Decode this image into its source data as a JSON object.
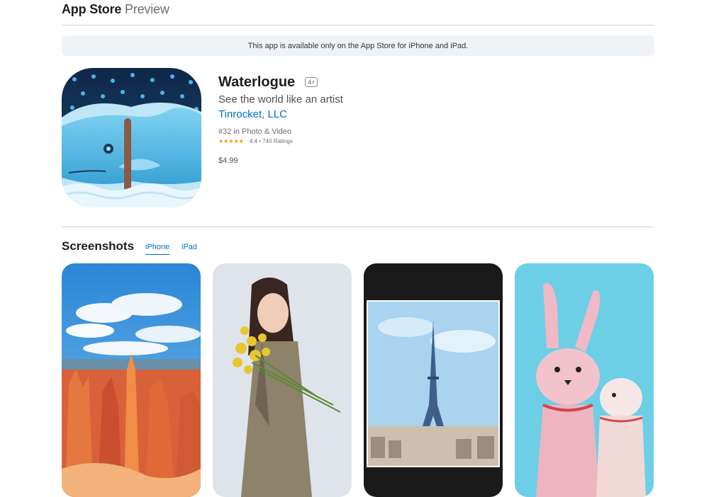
{
  "header": {
    "brand_bold": "App Store",
    "brand_light": "Preview"
  },
  "banner": {
    "text": "This app is available only on the App Store for iPhone and iPad."
  },
  "app": {
    "name": "Waterlogue",
    "age_rating": "4+",
    "subtitle": "See the world like an artist",
    "developer": "Tinrocket, LLC",
    "rank": "#32 in Photo & Video",
    "stars": "★★★★★",
    "rating_text": "4.4 • 740 Ratings",
    "price": "$4.99"
  },
  "screenshots": {
    "title": "Screenshots",
    "tabs": [
      {
        "label": "iPhone",
        "active": true
      },
      {
        "label": "iPad",
        "active": false
      }
    ],
    "items": [
      "landscape-canyon",
      "woman-with-flowers",
      "eiffel-tower",
      "bunny-puppets"
    ]
  },
  "colors": {
    "accent": "#0070c9",
    "star": "#ff9500",
    "banner_bg": "#f0f3f6"
  }
}
